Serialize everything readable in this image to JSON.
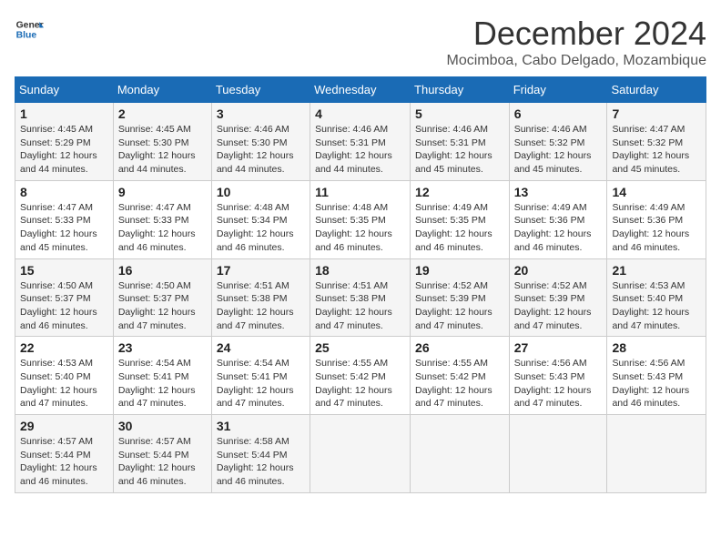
{
  "header": {
    "logo_line1": "General",
    "logo_line2": "Blue",
    "month_title": "December 2024",
    "location": "Mocimboa, Cabo Delgado, Mozambique"
  },
  "calendar": {
    "days_of_week": [
      "Sunday",
      "Monday",
      "Tuesday",
      "Wednesday",
      "Thursday",
      "Friday",
      "Saturday"
    ],
    "weeks": [
      [
        {
          "day": "",
          "sunrise": "",
          "sunset": "",
          "daylight": ""
        },
        {
          "day": "2",
          "sunrise": "Sunrise: 4:45 AM",
          "sunset": "Sunset: 5:30 PM",
          "daylight": "Daylight: 12 hours and 44 minutes."
        },
        {
          "day": "3",
          "sunrise": "Sunrise: 4:46 AM",
          "sunset": "Sunset: 5:30 PM",
          "daylight": "Daylight: 12 hours and 44 minutes."
        },
        {
          "day": "4",
          "sunrise": "Sunrise: 4:46 AM",
          "sunset": "Sunset: 5:31 PM",
          "daylight": "Daylight: 12 hours and 44 minutes."
        },
        {
          "day": "5",
          "sunrise": "Sunrise: 4:46 AM",
          "sunset": "Sunset: 5:31 PM",
          "daylight": "Daylight: 12 hours and 45 minutes."
        },
        {
          "day": "6",
          "sunrise": "Sunrise: 4:46 AM",
          "sunset": "Sunset: 5:32 PM",
          "daylight": "Daylight: 12 hours and 45 minutes."
        },
        {
          "day": "7",
          "sunrise": "Sunrise: 4:47 AM",
          "sunset": "Sunset: 5:32 PM",
          "daylight": "Daylight: 12 hours and 45 minutes."
        }
      ],
      [
        {
          "day": "8",
          "sunrise": "Sunrise: 4:47 AM",
          "sunset": "Sunset: 5:33 PM",
          "daylight": "Daylight: 12 hours and 45 minutes."
        },
        {
          "day": "9",
          "sunrise": "Sunrise: 4:47 AM",
          "sunset": "Sunset: 5:33 PM",
          "daylight": "Daylight: 12 hours and 46 minutes."
        },
        {
          "day": "10",
          "sunrise": "Sunrise: 4:48 AM",
          "sunset": "Sunset: 5:34 PM",
          "daylight": "Daylight: 12 hours and 46 minutes."
        },
        {
          "day": "11",
          "sunrise": "Sunrise: 4:48 AM",
          "sunset": "Sunset: 5:35 PM",
          "daylight": "Daylight: 12 hours and 46 minutes."
        },
        {
          "day": "12",
          "sunrise": "Sunrise: 4:49 AM",
          "sunset": "Sunset: 5:35 PM",
          "daylight": "Daylight: 12 hours and 46 minutes."
        },
        {
          "day": "13",
          "sunrise": "Sunrise: 4:49 AM",
          "sunset": "Sunset: 5:36 PM",
          "daylight": "Daylight: 12 hours and 46 minutes."
        },
        {
          "day": "14",
          "sunrise": "Sunrise: 4:49 AM",
          "sunset": "Sunset: 5:36 PM",
          "daylight": "Daylight: 12 hours and 46 minutes."
        }
      ],
      [
        {
          "day": "15",
          "sunrise": "Sunrise: 4:50 AM",
          "sunset": "Sunset: 5:37 PM",
          "daylight": "Daylight: 12 hours and 46 minutes."
        },
        {
          "day": "16",
          "sunrise": "Sunrise: 4:50 AM",
          "sunset": "Sunset: 5:37 PM",
          "daylight": "Daylight: 12 hours and 47 minutes."
        },
        {
          "day": "17",
          "sunrise": "Sunrise: 4:51 AM",
          "sunset": "Sunset: 5:38 PM",
          "daylight": "Daylight: 12 hours and 47 minutes."
        },
        {
          "day": "18",
          "sunrise": "Sunrise: 4:51 AM",
          "sunset": "Sunset: 5:38 PM",
          "daylight": "Daylight: 12 hours and 47 minutes."
        },
        {
          "day": "19",
          "sunrise": "Sunrise: 4:52 AM",
          "sunset": "Sunset: 5:39 PM",
          "daylight": "Daylight: 12 hours and 47 minutes."
        },
        {
          "day": "20",
          "sunrise": "Sunrise: 4:52 AM",
          "sunset": "Sunset: 5:39 PM",
          "daylight": "Daylight: 12 hours and 47 minutes."
        },
        {
          "day": "21",
          "sunrise": "Sunrise: 4:53 AM",
          "sunset": "Sunset: 5:40 PM",
          "daylight": "Daylight: 12 hours and 47 minutes."
        }
      ],
      [
        {
          "day": "22",
          "sunrise": "Sunrise: 4:53 AM",
          "sunset": "Sunset: 5:40 PM",
          "daylight": "Daylight: 12 hours and 47 minutes."
        },
        {
          "day": "23",
          "sunrise": "Sunrise: 4:54 AM",
          "sunset": "Sunset: 5:41 PM",
          "daylight": "Daylight: 12 hours and 47 minutes."
        },
        {
          "day": "24",
          "sunrise": "Sunrise: 4:54 AM",
          "sunset": "Sunset: 5:41 PM",
          "daylight": "Daylight: 12 hours and 47 minutes."
        },
        {
          "day": "25",
          "sunrise": "Sunrise: 4:55 AM",
          "sunset": "Sunset: 5:42 PM",
          "daylight": "Daylight: 12 hours and 47 minutes."
        },
        {
          "day": "26",
          "sunrise": "Sunrise: 4:55 AM",
          "sunset": "Sunset: 5:42 PM",
          "daylight": "Daylight: 12 hours and 47 minutes."
        },
        {
          "day": "27",
          "sunrise": "Sunrise: 4:56 AM",
          "sunset": "Sunset: 5:43 PM",
          "daylight": "Daylight: 12 hours and 47 minutes."
        },
        {
          "day": "28",
          "sunrise": "Sunrise: 4:56 AM",
          "sunset": "Sunset: 5:43 PM",
          "daylight": "Daylight: 12 hours and 46 minutes."
        }
      ],
      [
        {
          "day": "29",
          "sunrise": "Sunrise: 4:57 AM",
          "sunset": "Sunset: 5:44 PM",
          "daylight": "Daylight: 12 hours and 46 minutes."
        },
        {
          "day": "30",
          "sunrise": "Sunrise: 4:57 AM",
          "sunset": "Sunset: 5:44 PM",
          "daylight": "Daylight: 12 hours and 46 minutes."
        },
        {
          "day": "31",
          "sunrise": "Sunrise: 4:58 AM",
          "sunset": "Sunset: 5:44 PM",
          "daylight": "Daylight: 12 hours and 46 minutes."
        },
        {
          "day": "",
          "sunrise": "",
          "sunset": "",
          "daylight": ""
        },
        {
          "day": "",
          "sunrise": "",
          "sunset": "",
          "daylight": ""
        },
        {
          "day": "",
          "sunrise": "",
          "sunset": "",
          "daylight": ""
        },
        {
          "day": "",
          "sunrise": "",
          "sunset": "",
          "daylight": ""
        }
      ]
    ],
    "week1_sunday": {
      "day": "1",
      "sunrise": "Sunrise: 4:45 AM",
      "sunset": "Sunset: 5:29 PM",
      "daylight": "Daylight: 12 hours and 44 minutes."
    }
  }
}
